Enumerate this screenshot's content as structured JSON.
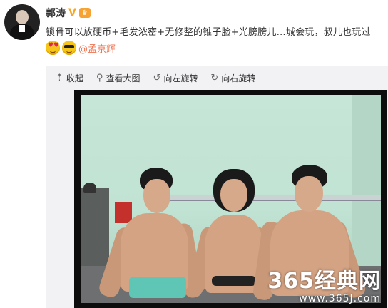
{
  "post": {
    "author": "郭涛",
    "verified_badge": "V",
    "level_badge": "♛",
    "text": "锁骨可以放硬币+毛发浓密+无修整的锥子脸+光膀膀儿…城会玩，叔儿也玩过",
    "mention": "@孟京辉"
  },
  "toolbar": {
    "collapse_label": "收起",
    "view_large_label": "查看大图",
    "rotate_left_label": "向左旋转",
    "rotate_right_label": "向右旋转"
  },
  "watermark": {
    "brand": "365经典网",
    "url": "www.365J.com"
  },
  "icons": {
    "collapse": "arrow-up-icon",
    "view_large": "magnifier-icon",
    "rotate_left": "rotate-left-icon",
    "rotate_right": "rotate-right-icon"
  },
  "colors": {
    "mention": "#eb7350",
    "verified": "#f5a623",
    "media_bg": "#f2f2f5"
  }
}
